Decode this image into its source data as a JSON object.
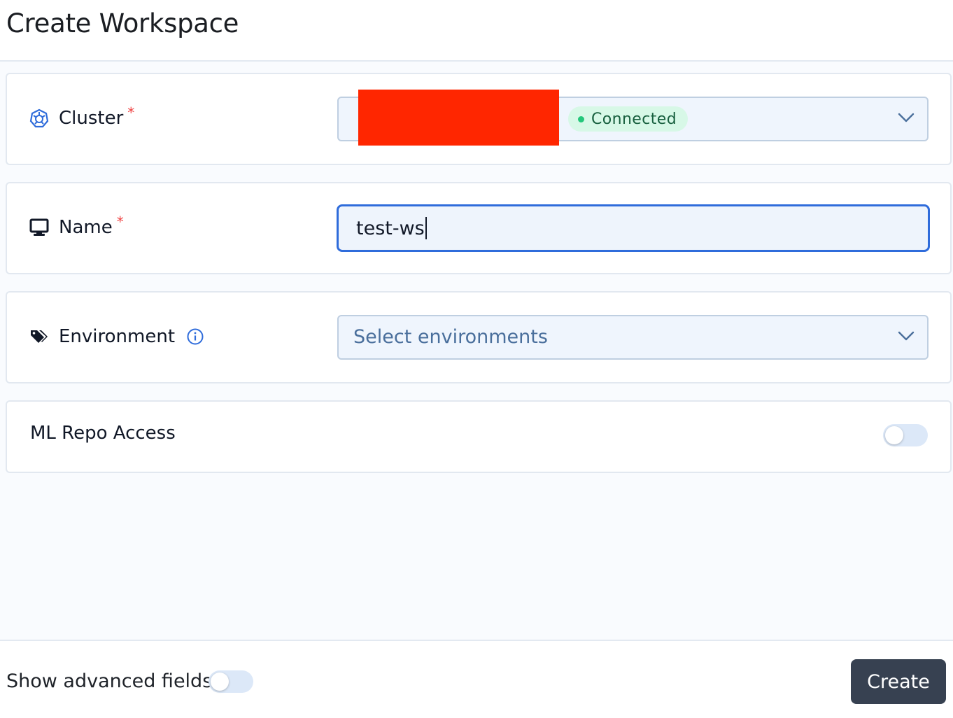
{
  "header": {
    "title": "Create Workspace"
  },
  "fields": {
    "cluster": {
      "label": "Cluster",
      "required_mark": "*",
      "icon": "kubernetes-helm-icon",
      "status": "Connected",
      "status_color": "#23c77b"
    },
    "name": {
      "label": "Name",
      "required_mark": "*",
      "icon": "monitor-icon",
      "value": "test-ws"
    },
    "environment": {
      "label": "Environment",
      "icon": "tags-icon",
      "info_icon": "info-circle-icon",
      "placeholder": "Select environments"
    },
    "ml_repo_access": {
      "label": "ML Repo Access",
      "enabled": false
    }
  },
  "footer": {
    "advanced_label": "Show advanced fields",
    "advanced_enabled": false,
    "create_label": "Create"
  },
  "colors": {
    "accent": "#2f6cdb",
    "required": "#ef4444",
    "primary_button": "#374151",
    "redaction": "#ff2600"
  }
}
